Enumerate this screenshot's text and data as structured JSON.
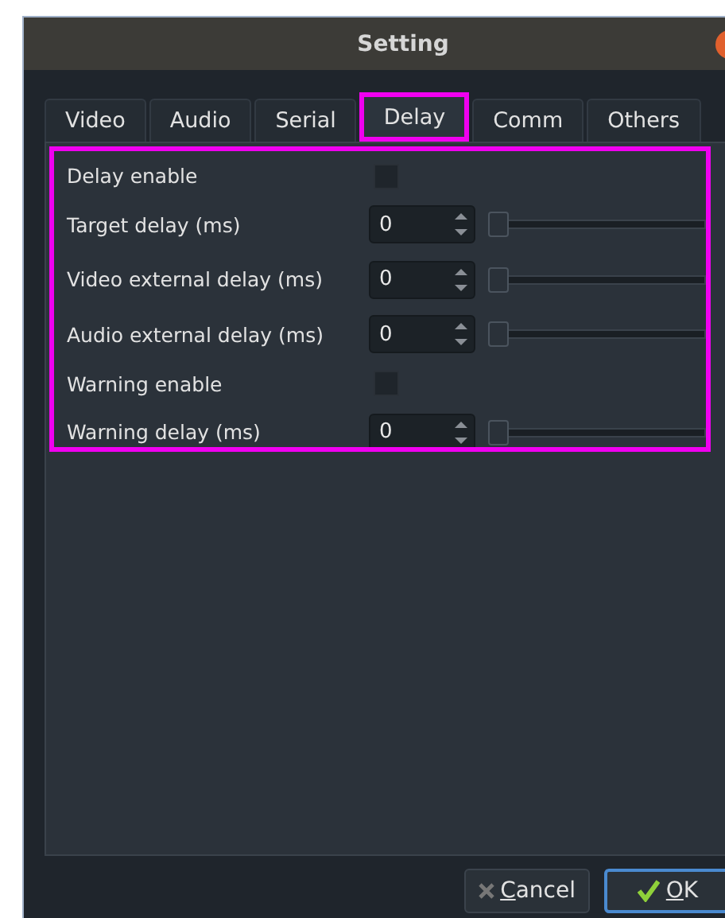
{
  "window": {
    "title": "Setting"
  },
  "tabs": [
    {
      "label": "Video",
      "selected": false
    },
    {
      "label": "Audio",
      "selected": false
    },
    {
      "label": "Serial",
      "selected": false
    },
    {
      "label": "Delay",
      "selected": true,
      "highlighted": true
    },
    {
      "label": "Comm",
      "selected": false
    },
    {
      "label": "Others",
      "selected": false
    }
  ],
  "panel": {
    "highlighted": true
  },
  "rows": [
    {
      "kind": "checkbox",
      "label": "Delay enable",
      "checked": false
    },
    {
      "kind": "spin-slider",
      "label": "Target delay (ms)",
      "value": "0",
      "level": 0
    },
    {
      "kind": "spin-slider",
      "label": "Video external delay (ms)",
      "value": "0",
      "level": 0
    },
    {
      "kind": "spin-slider",
      "label": "Audio external delay (ms)",
      "value": "0",
      "level": 0
    },
    {
      "kind": "checkbox",
      "label": "Warning enable",
      "checked": false
    },
    {
      "kind": "spin-slider",
      "label": "Warning delay (ms)",
      "value": "0",
      "level": 0
    }
  ],
  "buttons": [
    {
      "kind": "cancel",
      "label": "Cancel",
      "default": false
    },
    {
      "kind": "ok",
      "label": "OK",
      "default": true
    }
  ]
}
